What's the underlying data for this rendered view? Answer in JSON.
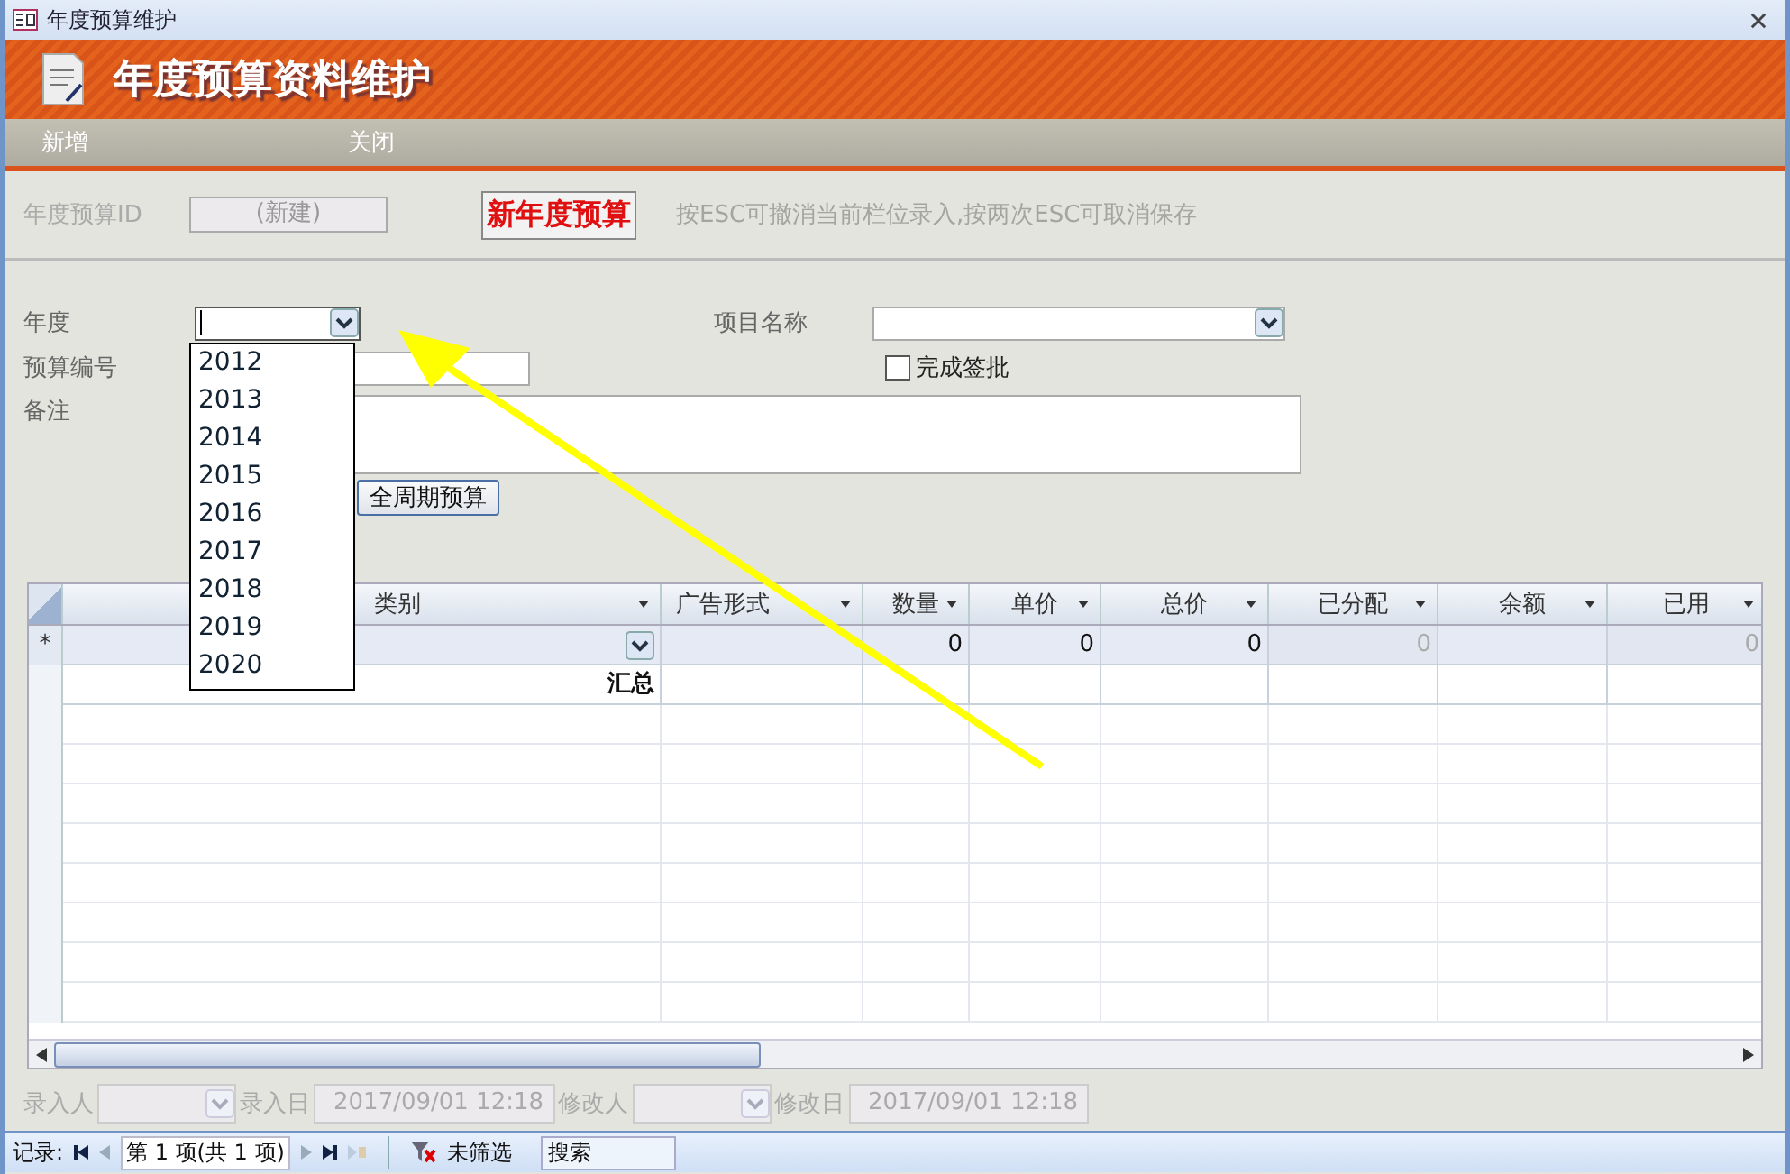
{
  "window": {
    "title": "年度预算维护"
  },
  "header": {
    "title": "年度预算资料维护"
  },
  "menu": [
    {
      "label": "新增"
    },
    {
      "label": "关闭"
    }
  ],
  "record_id": {
    "label": "年度预算ID",
    "value": "(新建)"
  },
  "status_label": "新年度预算",
  "hint": "按ESC可撤消当前栏位录入,按两次ESC可取消保存",
  "form": {
    "year": {
      "label": "年度",
      "expanded": true,
      "options": [
        "2012",
        "2013",
        "2014",
        "2015",
        "2016",
        "2017",
        "2018",
        "2019",
        "2020"
      ]
    },
    "project": {
      "label": "项目名称"
    },
    "budget_no": {
      "label": "预算编号"
    },
    "approved": {
      "label": "完成签批",
      "checked": false
    },
    "remark": {
      "label": "备注"
    },
    "button": "全周期预算"
  },
  "table": {
    "columns": [
      "类别",
      "广告形式",
      "数量",
      "单价",
      "总价",
      "已分配",
      "余额",
      "已用"
    ],
    "new_row": {
      "marker": "*",
      "cells": [
        {
          "disabled": false
        },
        {},
        {
          "value": "0",
          "disabled": false
        },
        {
          "value": "0",
          "disabled": false
        },
        {
          "value": "0",
          "disabled": false
        },
        {
          "value": "0",
          "disabled": true
        },
        {},
        {
          "value": "0",
          "disabled": true
        }
      ]
    },
    "summary": {
      "label": "汇总"
    }
  },
  "footer": [
    {
      "label": "录入人",
      "kind": "combo"
    },
    {
      "label": "录入日",
      "kind": "text",
      "value": "2017/09/01 12:18"
    },
    {
      "label": "修改人",
      "kind": "combo"
    },
    {
      "label": "修改日",
      "kind": "text",
      "value": "2017/09/01 12:18"
    }
  ],
  "nav": {
    "label": "记录:",
    "position": "第 1 项(共 1 项)",
    "filter": "未筛选",
    "search": "搜索"
  }
}
